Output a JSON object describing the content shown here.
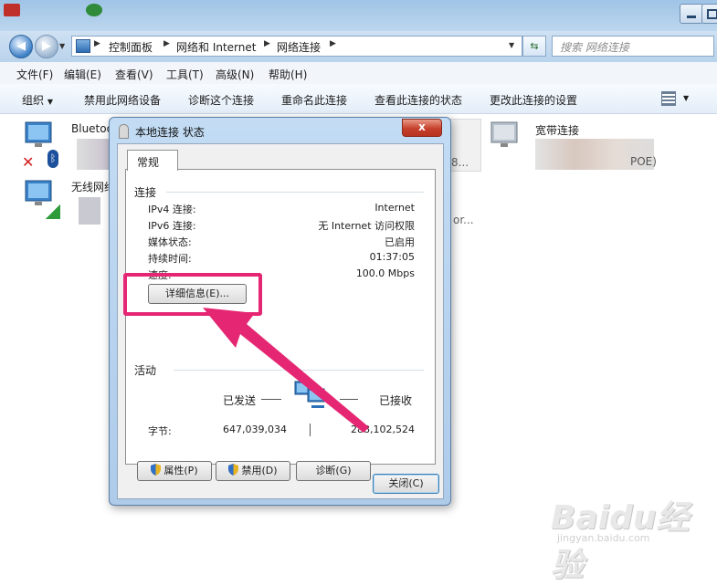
{
  "address": {
    "crumbs": [
      "控制面板",
      "网络和 Internet",
      "网络连接"
    ],
    "search_placeholder": "搜索 网络连接"
  },
  "menubar": [
    "文件(F)",
    "编辑(E)",
    "查看(V)",
    "工具(T)",
    "高级(N)",
    "帮助(H)"
  ],
  "toolbar": [
    "组织",
    "禁用此网络设备",
    "诊断这个连接",
    "重命名此连接",
    "查看此连接的状态",
    "更改此连接的设置"
  ],
  "connections": {
    "bluetooth_name": "Bluetoo",
    "wireless_name": "无线网络",
    "broadband_name": "宽带连接",
    "broadband_suffix": "POE)",
    "partial_texts": [
      "8...",
      "or..."
    ]
  },
  "dialog": {
    "title": "本地连接 状态",
    "close_symbol": "x",
    "tab": "常规",
    "connection_group": "连接",
    "rows": [
      {
        "label": "IPv4 连接:",
        "value": "Internet"
      },
      {
        "label": "IPv6 连接:",
        "value": "无 Internet 访问权限"
      },
      {
        "label": "媒体状态:",
        "value": "已启用"
      },
      {
        "label": "持续时间:",
        "value": "01:37:05"
      },
      {
        "label": "速度:",
        "value": "100.0 Mbps"
      }
    ],
    "details_button": "详细信息(E)...",
    "activity_group": "活动",
    "sent_label": "已发送",
    "received_label": "已接收",
    "bytes_label": "字节:",
    "bytes_sent": "647,039,034",
    "bytes_received": "288,102,524",
    "properties_button": "属性(P)",
    "disable_button": "禁用(D)",
    "diagnose_button": "诊断(G)",
    "close_button": "关闭(C)"
  },
  "watermark": {
    "brand": "Baidu经验",
    "url": "jingyan.baidu.com"
  },
  "colors": {
    "highlight": "#e52673",
    "titlebar": "#9fc4e6",
    "dialog_frame": "#aecbea"
  }
}
